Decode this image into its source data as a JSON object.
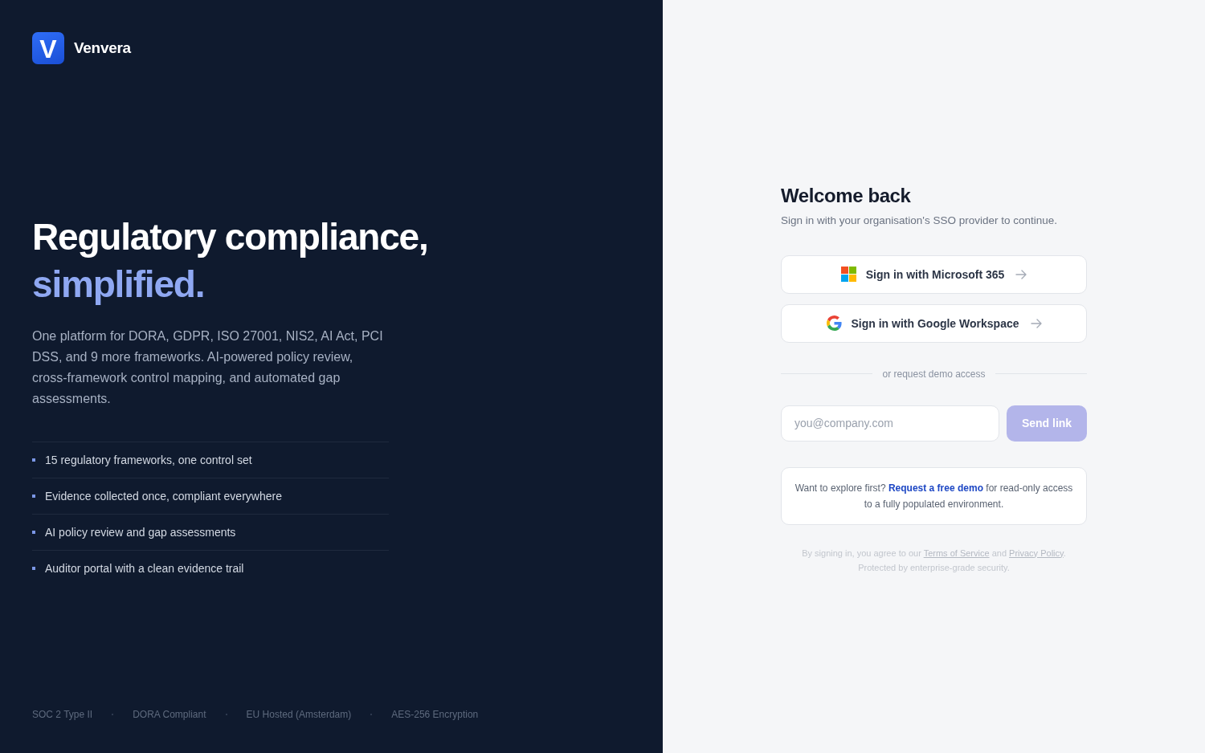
{
  "brand": {
    "mark": "V",
    "name": "Venvera"
  },
  "hero": {
    "headline": "Regulatory compliance,",
    "headline_accent": "simplified.",
    "description": "One platform for DORA, GDPR, ISO 27001, NIS2, AI Act, PCI DSS, and 9 more frameworks. AI-powered policy review, cross-framework control mapping, and automated gap assessments."
  },
  "features": [
    "15 regulatory frameworks, one control set",
    "Evidence collected once, compliant everywhere",
    "AI policy review and gap assessments",
    "Auditor portal with a clean evidence trail"
  ],
  "badges": [
    "SOC 2 Type II",
    "DORA Compliant",
    "EU Hosted (Amsterdam)",
    "AES-256 Encryption"
  ],
  "signin": {
    "title": "Welcome back",
    "subtitle": "Sign in with your organisation's SSO provider to continue.",
    "providers": [
      {
        "kind": "microsoft",
        "label": "Sign in with Microsoft 365"
      },
      {
        "kind": "google",
        "label": "Sign in with Google Workspace"
      }
    ],
    "divider": "or request demo access",
    "email": {
      "placeholder": "you@company.com"
    },
    "send_button": {
      "label": "Send link",
      "disabled": true
    },
    "demo_note": {
      "before": "Want to explore first?",
      "link": "Request a free demo",
      "after": "for read-only access to a fully populated environment."
    },
    "legal": {
      "prefix": "By signing in, you agree to our",
      "terms_link": "Terms of Service",
      "conjunction": "and",
      "privacy_link": "Privacy Policy",
      "suffix": ".",
      "security_note": "Protected by enterprise-grade security."
    }
  }
}
